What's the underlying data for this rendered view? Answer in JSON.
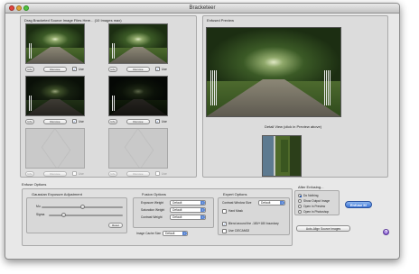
{
  "window": {
    "title": "Bracketeer"
  },
  "source": {
    "header": "Drag Bracketed Source Image Files Here... (10 Images max)",
    "slots": [
      {
        "info": "Info",
        "remove": "Remove",
        "use": "Use",
        "checked": true,
        "empty": false
      },
      {
        "info": "Info",
        "remove": "Remove",
        "use": "Use",
        "checked": true,
        "empty": false
      },
      {
        "info": "Info",
        "remove": "Remove",
        "use": "Use",
        "checked": true,
        "empty": false
      },
      {
        "info": "Info",
        "remove": "Remove",
        "use": "Use",
        "checked": true,
        "empty": false
      },
      {
        "info": "Info",
        "remove": "Remove",
        "use": "Use",
        "checked": false,
        "empty": true
      },
      {
        "info": "Info",
        "remove": "Remove",
        "use": "Use",
        "checked": false,
        "empty": true
      }
    ]
  },
  "preview": {
    "header": "Enfused Preview",
    "detail_header": "Detail View (click in Preview above)"
  },
  "enfuse_options": {
    "header": "Enfuse Options",
    "gaussian": {
      "header": "Gaussian Exposure Adjustment",
      "mu_label": "Mu",
      "sigma_label": "Sigma",
      "mu_value": 0.5,
      "sigma_value": 0.2,
      "reset_label": "Reset"
    },
    "fusion": {
      "header": "Fusion Options",
      "exposure_label": "Exposure Weight",
      "exposure_value": "Default",
      "saturation_label": "Saturation Weight",
      "saturation_value": "Default",
      "contrast_label": "Contrast Weight",
      "contrast_value": "Default",
      "cache_label": "Image Cache Size",
      "cache_value": "Default"
    },
    "expert": {
      "header": "Expert Options",
      "contrast_window_label": "Contrast Window Size",
      "contrast_window_value": "Default",
      "hard_mask_label": "Hard Mask",
      "blend_label": "Blend around the -180/+180 boundary",
      "ciecam_label": "Use CIECAM02"
    }
  },
  "after_enfusing": {
    "header": "After Enfusing...",
    "options": [
      {
        "label": "Do Nothing",
        "selected": true
      },
      {
        "label": "Show Output Image",
        "selected": false
      },
      {
        "label": "Open in Preview",
        "selected": false
      },
      {
        "label": "Open in Photoshop",
        "selected": false
      }
    ]
  },
  "actions": {
    "enfuse_label": "Enfuse It!",
    "auto_align_label": "Auto-Align Source Images",
    "help_label": "?"
  }
}
